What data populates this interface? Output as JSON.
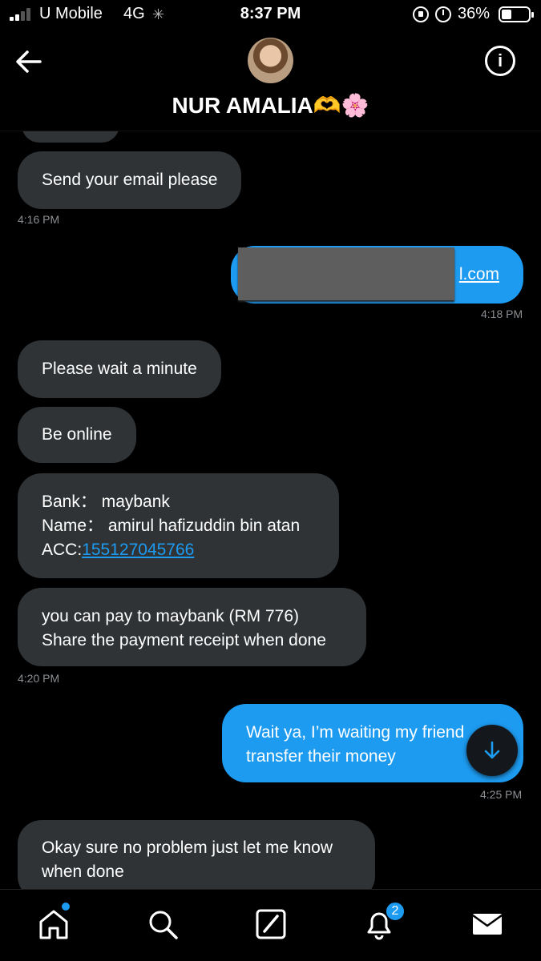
{
  "status_bar": {
    "carrier": "U Mobile",
    "network": "4G",
    "time": "8:37 PM",
    "battery_percent": "36%",
    "battery_level": 0.36
  },
  "header": {
    "contact_name": "NUR AMALIA🫶🌸",
    "back_icon": "arrow-left-icon",
    "info_icon": "info-circle-icon",
    "info_glyph": "i"
  },
  "messages": [
    {
      "direction": "in",
      "lines": [
        "Send your email please"
      ]
    },
    {
      "timestamp": "4:16 PM"
    },
    {
      "direction": "out",
      "lines": [
        "l.com"
      ]
    },
    {
      "timestamp": "4:18 PM"
    },
    {
      "direction": "in",
      "lines": [
        "Please wait a minute"
      ]
    },
    {
      "direction": "in",
      "lines": [
        "Be online"
      ]
    },
    {
      "direction": "in",
      "lines": [
        "Bank： maybank",
        "Name： amirul hafizuddin bin atan",
        "ACC:",
        "155127045766"
      ]
    },
    {
      "direction": "in",
      "lines": [
        "you can pay to maybank (RM 776)",
        "Share the payment receipt when done"
      ]
    },
    {
      "timestamp": "4:20 PM"
    },
    {
      "direction": "out",
      "lines": [
        "Wait ya, I’m waiting my friend",
        "transfer their money"
      ]
    },
    {
      "timestamp": "4:25 PM"
    },
    {
      "direction": "in",
      "lines": [
        "Okay sure no problem just let me know",
        "when done"
      ]
    }
  ],
  "bottom_nav": {
    "items": [
      "home-icon",
      "search-icon",
      "compose-icon",
      "bell-icon",
      "mail-icon"
    ],
    "notification_count": "2"
  },
  "colors": {
    "accent": "#1d9bf0",
    "incoming_bubble": "#2f3336",
    "background": "#000000",
    "timestamp": "#8b8f93"
  }
}
